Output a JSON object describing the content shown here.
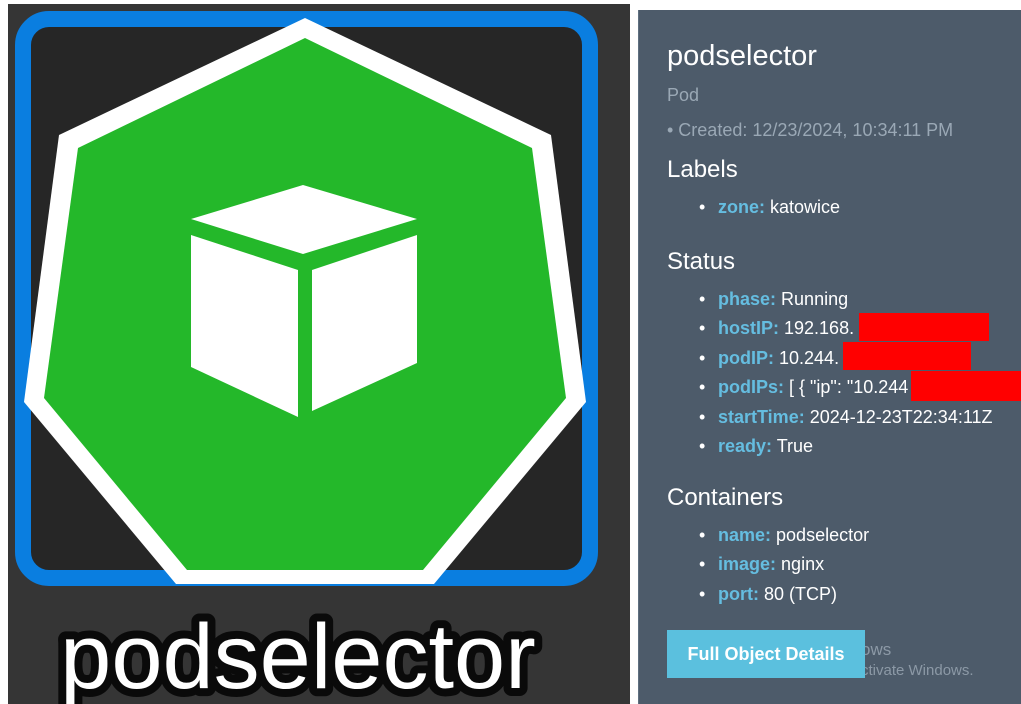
{
  "icon": {
    "name": "podselector",
    "frame_color": "#0a7ee0",
    "heptagon_color": "#24b82a",
    "cube_color": "#ffffff",
    "background_color": "#353535"
  },
  "details": {
    "name": "podselector",
    "kind": "Pod",
    "created": "• Created: 12/23/2024, 10:34:11 PM",
    "labels_title": "Labels",
    "labels": [
      {
        "key": "zone:",
        "value": "katowice"
      }
    ],
    "status_title": "Status",
    "status": [
      {
        "key": "phase:",
        "value": "Running"
      },
      {
        "key": "hostIP:",
        "value": "192.168."
      },
      {
        "key": "podIP:",
        "value": "10.244."
      },
      {
        "key": "podIPs:",
        "value": "[ { \"ip\": \"10.244"
      },
      {
        "key": "startTime:",
        "value": "2024-12-23T22:34:11Z"
      },
      {
        "key": "ready:",
        "value": "True"
      }
    ],
    "containers_title": "Containers",
    "containers": [
      {
        "key": "name:",
        "value": "podselector"
      },
      {
        "key": "image:",
        "value": "nginx"
      },
      {
        "key": "port:",
        "value": "80 (TCP)"
      }
    ],
    "button_label": "Full Object Details"
  },
  "watermark": {
    "line1": "ows",
    "line2": "ctivate Windows."
  },
  "colors": {
    "panel_bg": "#4d5b6a",
    "key_color": "#65bde0",
    "muted_text": "#9aa8b5",
    "button_bg": "#5bc0de",
    "redaction": "#ff0000"
  }
}
